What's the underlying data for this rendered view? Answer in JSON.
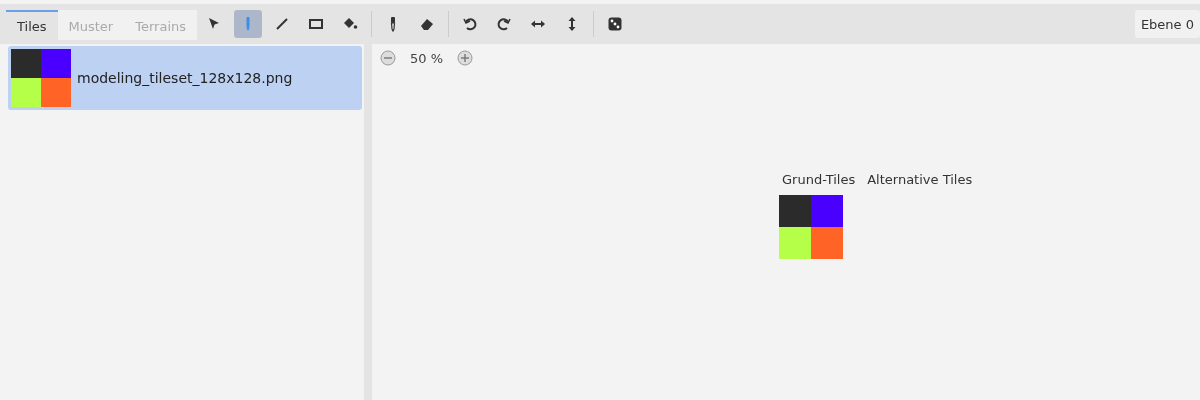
{
  "tabs": [
    {
      "label": "Tiles",
      "selected": true
    },
    {
      "label": "Muster",
      "selected": false
    },
    {
      "label": "Terrains",
      "selected": false
    }
  ],
  "tools": [
    {
      "kind": "select",
      "selected": false
    },
    {
      "kind": "pencil",
      "selected": true
    },
    {
      "kind": "line",
      "selected": false
    },
    {
      "kind": "rect",
      "selected": false
    },
    {
      "kind": "bucket",
      "selected": false
    },
    {
      "kind": "sep"
    },
    {
      "kind": "picker",
      "selected": false
    },
    {
      "kind": "eraser",
      "selected": false
    },
    {
      "kind": "sep"
    },
    {
      "kind": "rotate-left",
      "selected": false
    },
    {
      "kind": "rotate-right",
      "selected": false
    },
    {
      "kind": "flip-h",
      "selected": false
    },
    {
      "kind": "flip-v",
      "selected": false
    },
    {
      "kind": "sep"
    },
    {
      "kind": "dice",
      "selected": false
    }
  ],
  "layer": {
    "label": "Ebene 0"
  },
  "tilesets": [
    {
      "name": "modeling_tileset_128x128.png",
      "selected": true,
      "tiles": [
        {
          "color": "#2b2b2b"
        },
        {
          "color": "#4a00ff"
        },
        {
          "color": "#b6ff48"
        },
        {
          "color": "#ff6426"
        }
      ]
    }
  ],
  "zoom": {
    "reading": "50 %"
  },
  "atlas": {
    "base_label": "Grund-Tiles",
    "alt_label": "Alternative Tiles",
    "tiles": [
      {
        "color": "#2b2b2b"
      },
      {
        "color": "#4a00ff"
      },
      {
        "color": "#b6ff48"
      },
      {
        "color": "#ff6426"
      }
    ]
  }
}
